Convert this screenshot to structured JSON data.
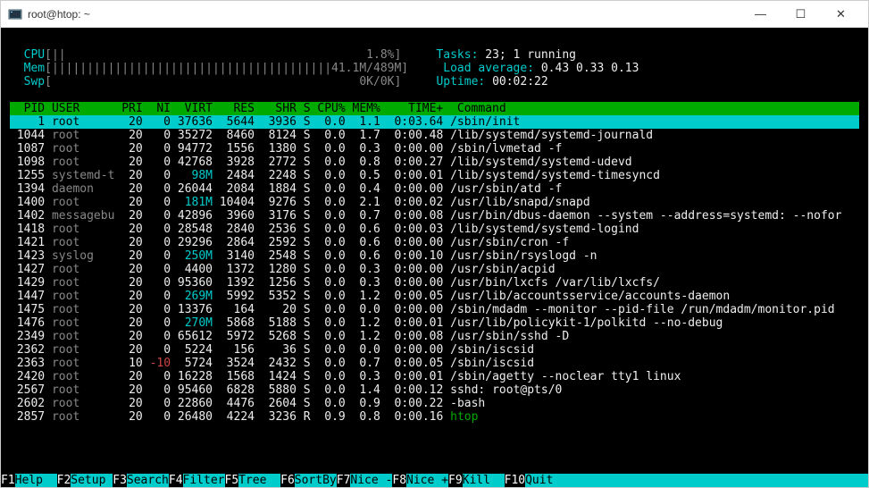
{
  "window": {
    "title": "root@htop: ~"
  },
  "meters": {
    "cpu": {
      "label": "CPU",
      "bar": "[||                                           1.8%]"
    },
    "mem": {
      "label": "Mem",
      "bar": "[||||||||||||||||||||||||||||||||||||||||41.1M/489M]"
    },
    "swp": {
      "label": "Swp",
      "bar": "[                                            0K/0K]"
    },
    "tasks_label": "Tasks: ",
    "tasks_value": "23; 1 running",
    "load_label": "Load average: ",
    "load_value": "0.43 0.33 0.13",
    "uptime_label": "Uptime: ",
    "uptime_value": "00:02:22"
  },
  "columns": {
    "pid": "PID",
    "user": "USER",
    "pri": "PRI",
    "ni": "NI",
    "virt": "VIRT",
    "res": "RES",
    "shr": "SHR",
    "s": "S",
    "cpu": "CPU%",
    "mem": "MEM%",
    "time": "TIME+",
    "command": "Command"
  },
  "processes": [
    {
      "pid": "1",
      "user": "root",
      "pri": "20",
      "ni": "0",
      "virt": "37636",
      "res": "5644",
      "shr": "3936",
      "s": "S",
      "cpu": "0.0",
      "mem": "1.1",
      "time": "0:03.64",
      "cmd": "/sbin/init",
      "sel": true
    },
    {
      "pid": "1044",
      "user": "root",
      "pri": "20",
      "ni": "0",
      "virt": "35272",
      "res": "8460",
      "shr": "8124",
      "s": "S",
      "cpu": "0.0",
      "mem": "1.7",
      "time": "0:00.48",
      "cmd": "/lib/systemd/systemd-journald"
    },
    {
      "pid": "1087",
      "user": "root",
      "pri": "20",
      "ni": "0",
      "virt": "94772",
      "res": "1556",
      "shr": "1380",
      "s": "S",
      "cpu": "0.0",
      "mem": "0.3",
      "time": "0:00.00",
      "cmd": "/sbin/lvmetad -f"
    },
    {
      "pid": "1098",
      "user": "root",
      "pri": "20",
      "ni": "0",
      "virt": "42768",
      "res": "3928",
      "shr": "2772",
      "s": "S",
      "cpu": "0.0",
      "mem": "0.8",
      "time": "0:00.27",
      "cmd": "/lib/systemd/systemd-udevd"
    },
    {
      "pid": "1255",
      "user": "systemd-t",
      "pri": "20",
      "ni": "0",
      "virt": "98M",
      "res": "2484",
      "shr": "2248",
      "s": "S",
      "cpu": "0.0",
      "mem": "0.5",
      "time": "0:00.01",
      "cmd": "/lib/systemd/systemd-timesyncd",
      "vc": true
    },
    {
      "pid": "1394",
      "user": "daemon",
      "pri": "20",
      "ni": "0",
      "virt": "26044",
      "res": "2084",
      "shr": "1884",
      "s": "S",
      "cpu": "0.0",
      "mem": "0.4",
      "time": "0:00.00",
      "cmd": "/usr/sbin/atd -f"
    },
    {
      "pid": "1400",
      "user": "root",
      "pri": "20",
      "ni": "0",
      "virt": "181M",
      "res": "10404",
      "shr": "9276",
      "s": "S",
      "cpu": "0.0",
      "mem": "2.1",
      "time": "0:00.02",
      "cmd": "/usr/lib/snapd/snapd",
      "vc": true
    },
    {
      "pid": "1402",
      "user": "messagebu",
      "pri": "20",
      "ni": "0",
      "virt": "42896",
      "res": "3960",
      "shr": "3176",
      "s": "S",
      "cpu": "0.0",
      "mem": "0.7",
      "time": "0:00.08",
      "cmd": "/usr/bin/dbus-daemon --system --address=systemd: --nofor"
    },
    {
      "pid": "1418",
      "user": "root",
      "pri": "20",
      "ni": "0",
      "virt": "28548",
      "res": "2840",
      "shr": "2536",
      "s": "S",
      "cpu": "0.0",
      "mem": "0.6",
      "time": "0:00.03",
      "cmd": "/lib/systemd/systemd-logind"
    },
    {
      "pid": "1421",
      "user": "root",
      "pri": "20",
      "ni": "0",
      "virt": "29296",
      "res": "2864",
      "shr": "2592",
      "s": "S",
      "cpu": "0.0",
      "mem": "0.6",
      "time": "0:00.00",
      "cmd": "/usr/sbin/cron -f"
    },
    {
      "pid": "1423",
      "user": "syslog",
      "pri": "20",
      "ni": "0",
      "virt": "250M",
      "res": "3140",
      "shr": "2548",
      "s": "S",
      "cpu": "0.0",
      "mem": "0.6",
      "time": "0:00.10",
      "cmd": "/usr/sbin/rsyslogd -n",
      "vc": true
    },
    {
      "pid": "1427",
      "user": "root",
      "pri": "20",
      "ni": "0",
      "virt": "4400",
      "res": "1372",
      "shr": "1280",
      "s": "S",
      "cpu": "0.0",
      "mem": "0.3",
      "time": "0:00.00",
      "cmd": "/usr/sbin/acpid"
    },
    {
      "pid": "1429",
      "user": "root",
      "pri": "20",
      "ni": "0",
      "virt": "95360",
      "res": "1392",
      "shr": "1256",
      "s": "S",
      "cpu": "0.0",
      "mem": "0.3",
      "time": "0:00.00",
      "cmd": "/usr/bin/lxcfs /var/lib/lxcfs/"
    },
    {
      "pid": "1447",
      "user": "root",
      "pri": "20",
      "ni": "0",
      "virt": "269M",
      "res": "5992",
      "shr": "5352",
      "s": "S",
      "cpu": "0.0",
      "mem": "1.2",
      "time": "0:00.05",
      "cmd": "/usr/lib/accountsservice/accounts-daemon",
      "vc": true
    },
    {
      "pid": "1475",
      "user": "root",
      "pri": "20",
      "ni": "0",
      "virt": "13376",
      "res": "164",
      "shr": "20",
      "s": "S",
      "cpu": "0.0",
      "mem": "0.0",
      "time": "0:00.00",
      "cmd": "/sbin/mdadm --monitor --pid-file /run/mdadm/monitor.pid"
    },
    {
      "pid": "1476",
      "user": "root",
      "pri": "20",
      "ni": "0",
      "virt": "270M",
      "res": "5868",
      "shr": "5188",
      "s": "S",
      "cpu": "0.0",
      "mem": "1.2",
      "time": "0:00.01",
      "cmd": "/usr/lib/policykit-1/polkitd --no-debug",
      "vc": true
    },
    {
      "pid": "2349",
      "user": "root",
      "pri": "20",
      "ni": "0",
      "virt": "65612",
      "res": "5972",
      "shr": "5268",
      "s": "S",
      "cpu": "0.0",
      "mem": "1.2",
      "time": "0:00.08",
      "cmd": "/usr/sbin/sshd -D"
    },
    {
      "pid": "2362",
      "user": "root",
      "pri": "20",
      "ni": "0",
      "virt": "5224",
      "res": "156",
      "shr": "36",
      "s": "S",
      "cpu": "0.0",
      "mem": "0.0",
      "time": "0:00.00",
      "cmd": "/sbin/iscsid"
    },
    {
      "pid": "2363",
      "user": "root",
      "pri": "10",
      "ni": "-10",
      "virt": "5724",
      "res": "3524",
      "shr": "2432",
      "s": "S",
      "cpu": "0.0",
      "mem": "0.7",
      "time": "0:00.05",
      "cmd": "/sbin/iscsid",
      "nired": true
    },
    {
      "pid": "2420",
      "user": "root",
      "pri": "20",
      "ni": "0",
      "virt": "16228",
      "res": "1568",
      "shr": "1424",
      "s": "S",
      "cpu": "0.0",
      "mem": "0.3",
      "time": "0:00.01",
      "cmd": "/sbin/agetty --noclear tty1 linux"
    },
    {
      "pid": "2567",
      "user": "root",
      "pri": "20",
      "ni": "0",
      "virt": "95460",
      "res": "6828",
      "shr": "5880",
      "s": "S",
      "cpu": "0.0",
      "mem": "1.4",
      "time": "0:00.12",
      "cmd": "sshd: root@pts/0"
    },
    {
      "pid": "2602",
      "user": "root",
      "pri": "20",
      "ni": "0",
      "virt": "22860",
      "res": "4476",
      "shr": "2604",
      "s": "S",
      "cpu": "0.0",
      "mem": "0.9",
      "time": "0:00.22",
      "cmd": "-bash"
    },
    {
      "pid": "2857",
      "user": "root",
      "pri": "20",
      "ni": "0",
      "virt": "26480",
      "res": "4224",
      "shr": "3236",
      "s": "R",
      "cpu": "0.9",
      "mem": "0.8",
      "time": "0:00.16",
      "cmd": "htop",
      "running": true
    }
  ],
  "footer": [
    {
      "key": "F1",
      "label": "Help  "
    },
    {
      "key": "F2",
      "label": "Setup "
    },
    {
      "key": "F3",
      "label": "Search"
    },
    {
      "key": "F4",
      "label": "Filter"
    },
    {
      "key": "F5",
      "label": "Tree  "
    },
    {
      "key": "F6",
      "label": "SortBy"
    },
    {
      "key": "F7",
      "label": "Nice -"
    },
    {
      "key": "F8",
      "label": "Nice +"
    },
    {
      "key": "F9",
      "label": "Kill  "
    },
    {
      "key": "F10",
      "label": "Quit"
    }
  ]
}
